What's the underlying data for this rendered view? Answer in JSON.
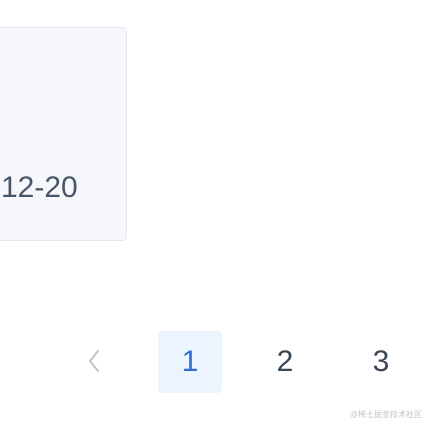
{
  "card": {
    "date_text": "12-20"
  },
  "pagination": {
    "prev_icon": "chevron-left-icon",
    "pages": [
      "1",
      "2",
      "3"
    ],
    "current_page": 1
  },
  "watermark": {
    "text": "@稀土掘金技术社区"
  },
  "colors": {
    "active_page_bg": "#ecf5ff",
    "active_page_text": "#2f6fd1",
    "page_text": "#3a4656",
    "card_bg": "#f5f7fa"
  }
}
